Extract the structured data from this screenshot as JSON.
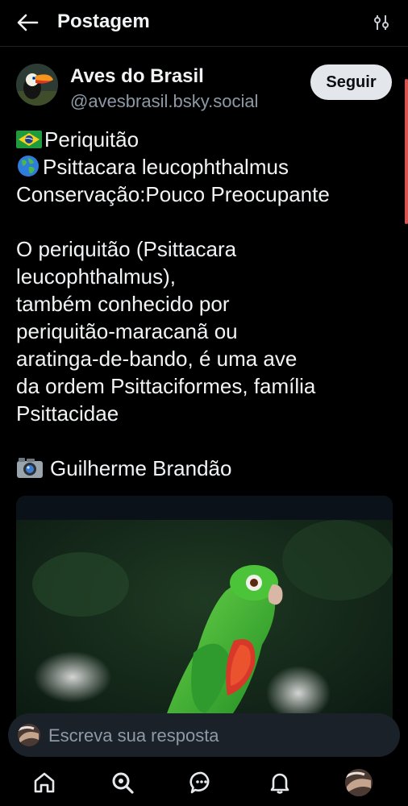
{
  "header": {
    "title": "Postagem",
    "back_icon": "arrow-left-icon",
    "filter_icon": "sliders-icon"
  },
  "author": {
    "name": "Aves do Brasil",
    "handle": "@avesbrasil.bsky.social",
    "avatar_icon": "toucan-avatar",
    "follow_label": "Seguir"
  },
  "post": {
    "line1": "Periquitão",
    "line2": "Psittacara leucophthalmus",
    "line3": "Conservação:Pouco Preocupante",
    "para1": [
      "O periquitão (Psittacara",
      "leucophthalmus),",
      "também conhecido por",
      "periquitão-maracanã ou",
      "aratinga-de-bando, é uma ave",
      "da ordem Psittaciformes, família",
      "Psittacidae"
    ],
    "credit": "Guilherme Brandão",
    "flag_icon": "brazil-flag-icon",
    "globe_icon": "globe-icon",
    "camera_icon": "camera-icon"
  },
  "reply": {
    "placeholder": "Escreva sua resposta"
  },
  "nav": {
    "items": [
      "home-icon",
      "search-icon",
      "chat-icon",
      "bell-icon",
      "profile-avatar"
    ]
  },
  "colors": {
    "background": "#000000",
    "text": "#f1f3f5",
    "muted": "#8d99a5",
    "follow_bg": "#e3e7eb",
    "reply_bg": "#1b2128",
    "scroll_accent": "#d9534f"
  }
}
